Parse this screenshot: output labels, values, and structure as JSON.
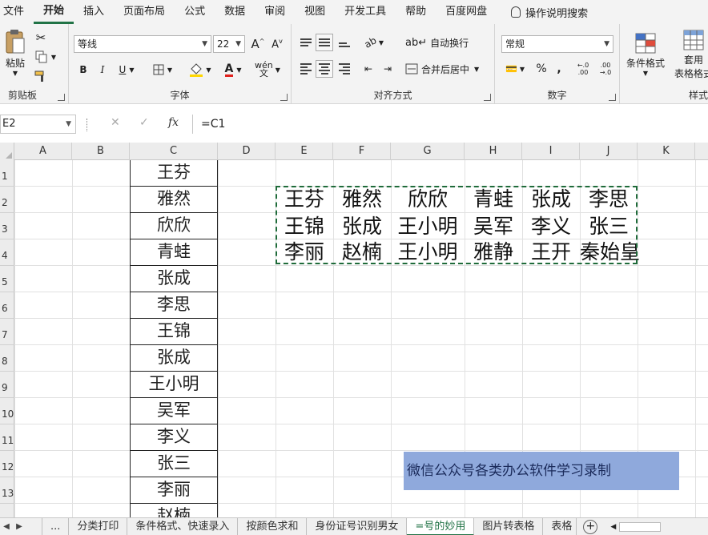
{
  "menu": {
    "tabs": [
      "文件",
      "开始",
      "插入",
      "页面布局",
      "公式",
      "数据",
      "审阅",
      "视图",
      "开发工具",
      "帮助",
      "百度网盘"
    ],
    "active": "开始",
    "help_search": "操作说明搜索"
  },
  "ribbon": {
    "clipboard": {
      "paste_label": "粘贴",
      "group_label": "剪贴板"
    },
    "font": {
      "font_name": "等线",
      "font_size": "22",
      "group_label": "字体",
      "bold": "B",
      "italic": "I",
      "underline": "U"
    },
    "alignment": {
      "wrap_text": "自动换行",
      "merge_center": "合并后居中",
      "group_label": "对齐方式"
    },
    "number": {
      "format": "常规",
      "group_label": "数字",
      "percent": "%",
      "comma": ",",
      "inc_decimal": "←.0 .00",
      "dec_decimal": ".00 →.0"
    },
    "styles": {
      "conditional_format": "条件格式",
      "format_as_table_1": "套用",
      "format_as_table_2": "表格格式",
      "group_label": "样式"
    }
  },
  "formula_bar": {
    "name_box": "E2",
    "formula": "=C1",
    "fx": "fx"
  },
  "columns": [
    "A",
    "B",
    "C",
    "D",
    "E",
    "F",
    "G",
    "H",
    "I",
    "J",
    "K"
  ],
  "rows": [
    "1",
    "2",
    "3",
    "4",
    "5",
    "6",
    "7",
    "8",
    "9",
    "10",
    "11",
    "12",
    "13"
  ],
  "column_c_values": [
    "王芬",
    "雅然",
    "欣欣",
    "青蛙",
    "张成",
    "李思",
    "王锦",
    "张成",
    "王小明",
    "吴军",
    "李义",
    "张三",
    "李丽",
    "赵楠"
  ],
  "matrix": [
    [
      "王芬",
      "雅然",
      "欣欣",
      "青蛙",
      "张成",
      "李思"
    ],
    [
      "王锦",
      "张成",
      "王小明",
      "吴军",
      "李义",
      "张三"
    ],
    [
      "李丽",
      "赵楠",
      "王小明",
      "雅静",
      "王开",
      "秦始皇"
    ]
  ],
  "banner_text": "微信公众号各类办公软件学习录制",
  "sheet_tabs": {
    "more": "...",
    "tabs": [
      "分类打印",
      "条件格式、快速录入",
      "按颜色求和",
      "身份证号识别男女",
      "=号的妙用",
      "图片转表格",
      "表格"
    ],
    "active": "=号的妙用",
    "add": "+"
  },
  "colors": {
    "accent": "#217346",
    "banner_bg": "#8fa9dc",
    "marquee": "#1f6b3a"
  }
}
